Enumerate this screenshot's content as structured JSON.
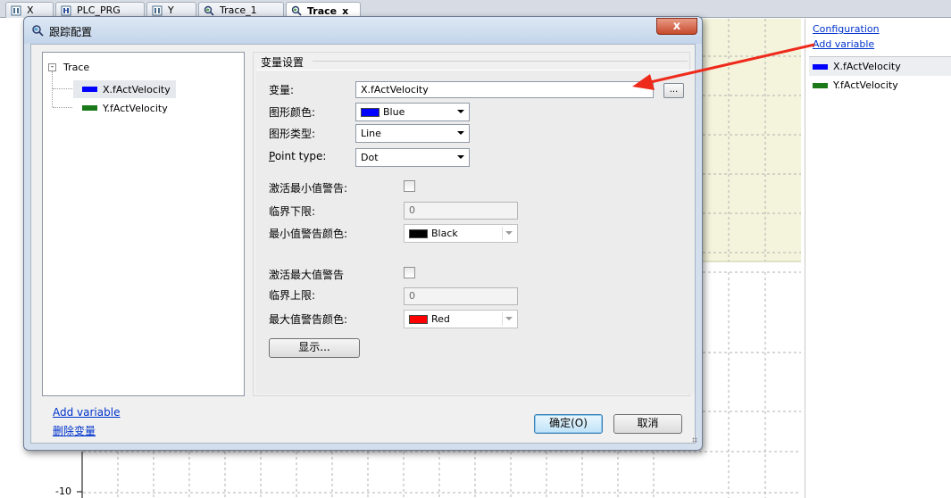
{
  "tabs": [
    {
      "label": "X",
      "icon": "pou-icon"
    },
    {
      "label": "PLC_PRG",
      "icon": "program-icon"
    },
    {
      "label": "Y",
      "icon": "pou-icon"
    },
    {
      "label": "Trace_1",
      "icon": "trace-icon"
    },
    {
      "label": "Trace",
      "icon": "trace-icon",
      "active": true,
      "close": "x"
    }
  ],
  "plot": {
    "y_tick_label": "-10"
  },
  "right_panel": {
    "configuration_link": "Configuration",
    "add_variable_link": "Add variable",
    "variables": [
      {
        "name": "X.fActVelocity",
        "color": "#0000ff"
      },
      {
        "name": "Y.fActVelocity",
        "color": "#1a7a1a"
      }
    ]
  },
  "dialog": {
    "title": "跟踪配置",
    "close_glyph": "x",
    "tree": {
      "root": "Trace",
      "expander": "-",
      "items": [
        {
          "name": "X.fActVelocity",
          "color": "#0000ff"
        },
        {
          "name": "Y.fActVelocity",
          "color": "#1a7a1a"
        }
      ]
    },
    "settings": {
      "group_title": "变量设置",
      "variable_label": "变量:",
      "variable_value": "X.fActVelocity",
      "browse_label": "...",
      "graph_color_label": "图形颜色:",
      "graph_color_value": "Blue",
      "graph_color_hex": "#0000ff",
      "graph_type_label": "图形类型:",
      "graph_type_value": "Line",
      "point_type_label_first": "P",
      "point_type_label_rest": "oint type:",
      "point_type_value": "Dot",
      "activate_min_warning_label": "激活最小值警告:",
      "min_threshold_label": "临界下限:",
      "min_threshold_value": "0",
      "min_warning_color_label": "最小值警告颜色:",
      "min_warning_color_value": "Black",
      "min_warning_color_hex": "#000000",
      "activate_max_warning_label": "激活最大值警告",
      "max_threshold_label": "临界上限:",
      "max_threshold_value": "0",
      "max_warning_color_label": "最大值警告颜色:",
      "max_warning_color_value": "Red",
      "max_warning_color_hex": "#ff0000",
      "display_button": "显示..."
    },
    "add_variable_link": "Add variable",
    "delete_variable_link": "删除变量",
    "ok_button": "确定(O)",
    "cancel_button": "取消"
  },
  "annotation_color": "#ee2a1b"
}
